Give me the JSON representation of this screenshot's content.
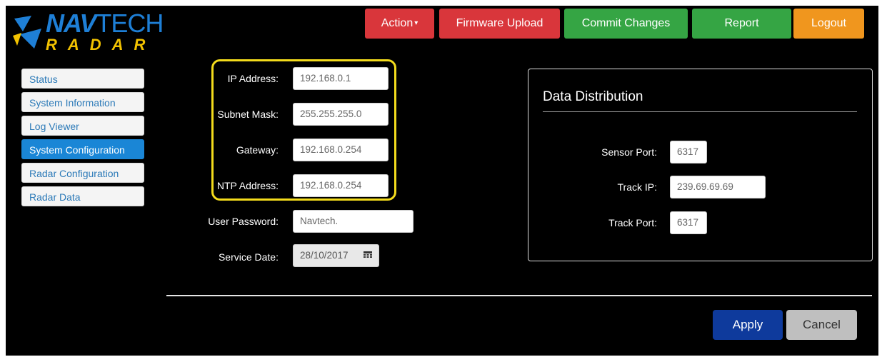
{
  "logo": {
    "top_a": "NAV",
    "top_b": "TECH",
    "bottom": "RADAR"
  },
  "header": {
    "action_label": "Action",
    "firmware_label": "Firmware Upload",
    "commit_label": "Commit Changes",
    "report_label": "Report",
    "logout_label": "Logout"
  },
  "sidebar": {
    "items": [
      {
        "label": "Status"
      },
      {
        "label": "System Information"
      },
      {
        "label": "Log Viewer"
      },
      {
        "label": "System Configuration"
      },
      {
        "label": "Radar Configuration"
      },
      {
        "label": "Radar Data"
      }
    ]
  },
  "form": {
    "ip_label": "IP Address:",
    "ip_value": "192.168.0.1",
    "subnet_label": "Subnet Mask:",
    "subnet_value": "255.255.255.0",
    "gateway_label": "Gateway:",
    "gateway_value": "192.168.0.254",
    "ntp_label": "NTP Address:",
    "ntp_value": "192.168.0.254",
    "password_label": "User Password:",
    "password_value": "Navtech.",
    "service_label": "Service Date:",
    "service_value": "28/10/2017"
  },
  "distribution": {
    "title": "Data Distribution",
    "sensor_port_label": "Sensor Port:",
    "sensor_port_value": "6317",
    "track_ip_label": "Track IP:",
    "track_ip_value": "239.69.69.69",
    "track_port_label": "Track Port:",
    "track_port_value": "6317"
  },
  "footer": {
    "apply_label": "Apply",
    "cancel_label": "Cancel"
  },
  "colors": {
    "accent_blue": "#1a86d6",
    "red": "#d9363b",
    "green": "#35a544",
    "orange": "#f0961e",
    "highlight_yellow": "#f3db1c",
    "apply_blue": "#0e3a9c"
  }
}
